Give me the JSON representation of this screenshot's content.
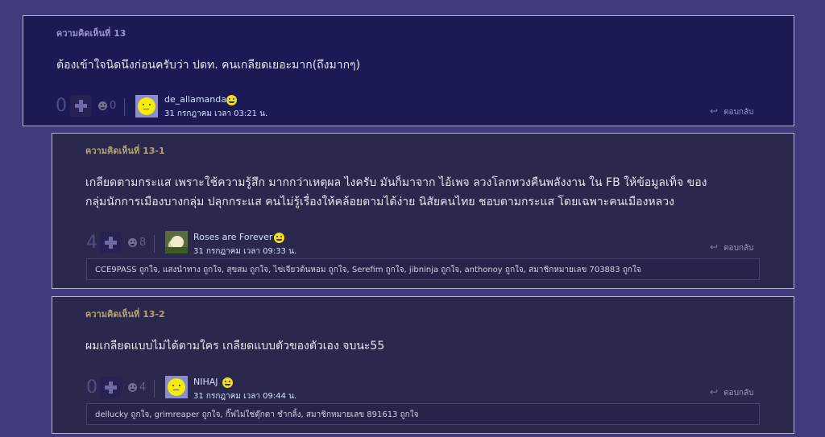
{
  "comments": [
    {
      "header": "ความคิดเห็นที่ 13",
      "header_color": "#9896c9",
      "lines": [
        "ต้องเข้าใจนิดนึงก่อนครับว่า  ปดท. คนเกลียดเยอะมาก(ถึงมากๆ)"
      ],
      "votes": "0",
      "emotions": "0",
      "username": "de_allamanda",
      "avatar_icon": "smiley-face-avatar",
      "date": "31 กรกฎาคม เวลา 03:21 น.",
      "reply_label": "ตอบกลับ"
    },
    {
      "header": "ความคิดเห็นที่ 13-1",
      "header_color": "#b4a36f",
      "lines": [
        "เกลียดตามกระแส เพราะใช้ความรู้สึก มากกว่าเหตุผล ไงครับ มันก็มาจาก ไอ้เพจ ลวงโลกทวงคืนพลังงาน ใน FB ให้ข้อมูลเท็จ ของ",
        "กลุ่มนักการเมืองบางกลุ่ม ปลุกกระแส คนไม่รู้เรื่องให้คล้อยตามได้ง่าย นิสัยคนไทย ชอบตามกระแส โดยเฉพาะคนเมืองหลวง"
      ],
      "votes": "4",
      "emotions": "8",
      "username": "Roses are Forever",
      "avatar_icon": "flower-photo-avatar",
      "date": "31 กรกฎาคม เวลา 09:33 น.",
      "reply_label": "ตอบกลับ",
      "likes": "CCE9PASS ถูกใจ, แสงนำทาง ถูกใจ, สุขสม ถูกใจ, ไข่เจียวต้นหอม ถูกใจ, Serefim ถูกใจ, jibninja ถูกใจ, anthonoy ถูกใจ, สมาชิกหมายเลข 703883 ถูกใจ"
    },
    {
      "header": "ความคิดเห็นที่ 13-2",
      "header_color": "#b4a36f",
      "lines": [
        "ผมเกลียดแบบไม่ได้ตามใคร เกลียดแบบตัวของตัวเอง จบนะ55"
      ],
      "votes": "0",
      "emotions": "4",
      "username": "NIHAJ",
      "avatar_icon": "smiley-face-avatar",
      "date": "31 กรกฎาคม เวลา 09:44 น.",
      "reply_label": "ตอบกลับ",
      "likes": "dellucky ถูกใจ, grimreaper ถูกใจ, กิ๊ฟไม่ใช่ตุ๊กตา ชำกลิ้ง, สมาชิกหมายเลข 891613 ถูกใจ"
    }
  ],
  "icons": {
    "vote_button": "plus-icon",
    "emotion": "emotion-face-icon",
    "user_badge": "smiley-badge-icon",
    "reply": "reply-arrow-icon"
  }
}
